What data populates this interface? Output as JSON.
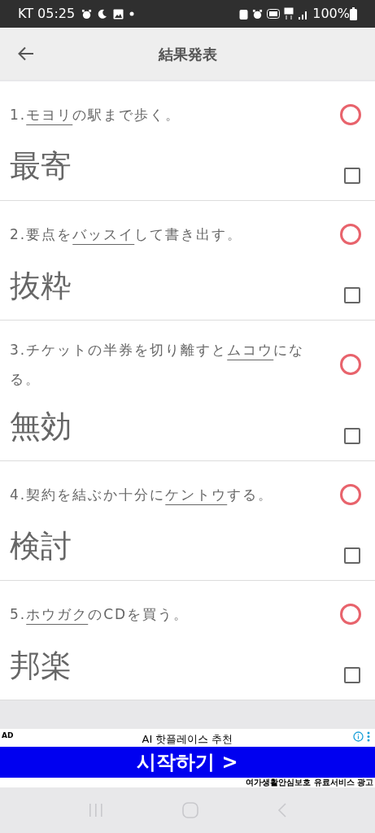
{
  "status_bar": {
    "carrier_time": "KT 05:25",
    "battery": "100%"
  },
  "header": {
    "title": "結果発表"
  },
  "questions": [
    {
      "kind": "correct",
      "number": "1.",
      "underlined": "モヨリ",
      "after": "の駅まで歩く。",
      "answer": "最寄",
      "checked": false
    },
    {
      "kind": "correct",
      "number": "2.",
      "before": "要点を",
      "underlined": "バッスイ",
      "after": "して書き出す。",
      "answer": "抜粋",
      "checked": false
    },
    {
      "kind": "correct",
      "number": "3.",
      "before": "チケットの半券を切り離すと",
      "underlined": "ムコウ",
      "after": "になる。",
      "answer": "無効",
      "checked": false
    },
    {
      "kind": "correct",
      "number": "4.",
      "before": "契約を結ぶか十分に",
      "underlined": "ケントウ",
      "after": "する。",
      "answer": "検討",
      "checked": false
    },
    {
      "kind": "correct",
      "number": "5.",
      "underlined": "ホウガク",
      "after": "のCDを買う。",
      "answer": "邦楽",
      "checked": false
    }
  ],
  "ad": {
    "badge": "AD",
    "headline": "AI 핫플레이스 추천",
    "cta": "시작하기 >",
    "disclaimer": "여가생활안심보호 유료서비스 광고"
  }
}
